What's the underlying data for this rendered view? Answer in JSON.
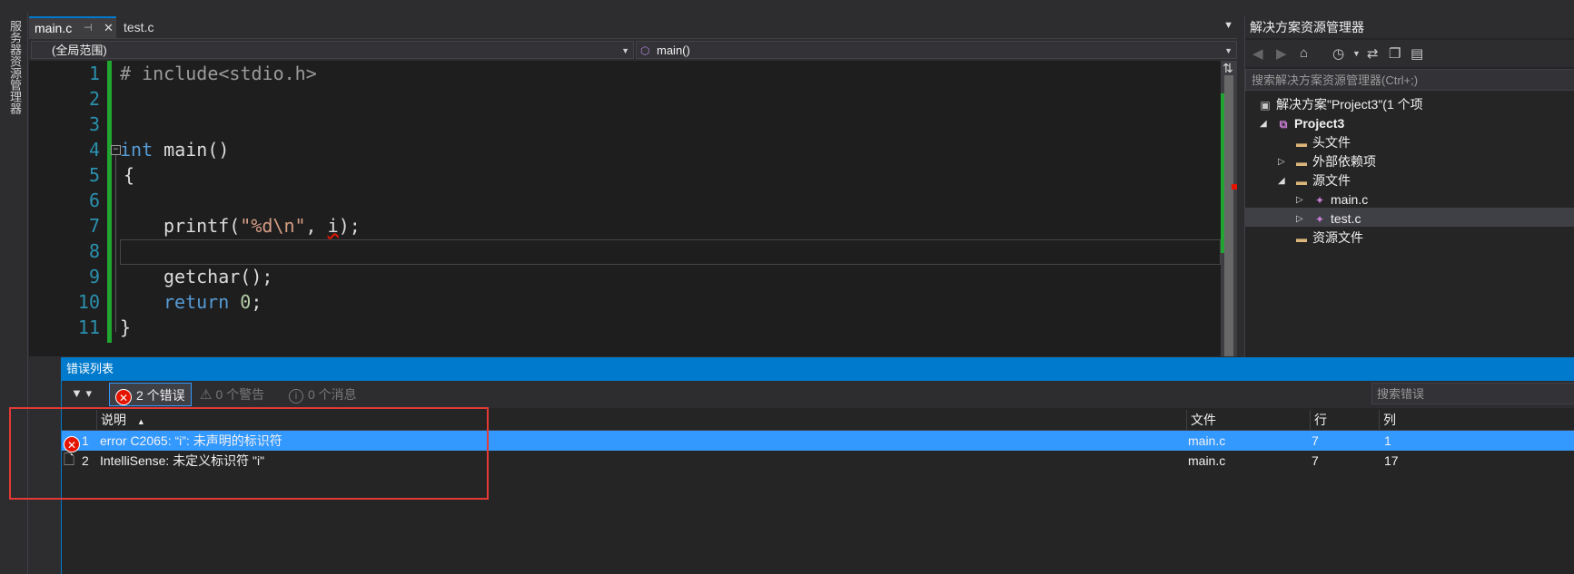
{
  "left_strip": {
    "label": "服务器资源管理器"
  },
  "tabs": [
    {
      "label": "main.c",
      "active": true
    },
    {
      "label": "test.c",
      "active": false
    }
  ],
  "navbar": {
    "scope": "(全局范围)",
    "function": "main()"
  },
  "editor": {
    "lines": [
      {
        "num": "1"
      },
      {
        "num": "2"
      },
      {
        "num": "3"
      },
      {
        "num": "4"
      },
      {
        "num": "5"
      },
      {
        "num": "6"
      },
      {
        "num": "7"
      },
      {
        "num": "8"
      },
      {
        "num": "9"
      },
      {
        "num": "10"
      },
      {
        "num": "11"
      }
    ],
    "code": {
      "l1_pp": "# include",
      "l1_hdr": "<stdio.h>",
      "l4_kw": "int",
      "l4_rest": " main()",
      "l5": "{",
      "l7_fn": "printf(",
      "l7_str": "\"%d\\n\"",
      "l7_sep": ", ",
      "l7_err": "i",
      "l7_end": ");",
      "l9": "getchar();",
      "l10_kw": "return",
      "l10_num": "0",
      "l10_end": ";",
      "l11": "}"
    }
  },
  "solution_explorer": {
    "title": "解决方案资源管理器",
    "search_placeholder": "搜索解决方案资源管理器(Ctrl+;)",
    "solution": "解决方案\"Project3\"(1 个项",
    "project": "Project3",
    "items": {
      "headers": "头文件",
      "external": "外部依赖项",
      "sources": "源文件",
      "main_c": "main.c",
      "test_c": "test.c",
      "resources": "资源文件"
    }
  },
  "error_list": {
    "title": "错误列表",
    "errors_btn": "2 个错误",
    "warnings_btn": "0 个警告",
    "messages_btn": "0 个消息",
    "search_placeholder": "搜索错误",
    "columns": {
      "desc": "说明",
      "file": "文件",
      "line": "行",
      "col": "列"
    },
    "rows": [
      {
        "num": "1",
        "desc": "error C2065: “i”: 未声明的标识符",
        "file": "main.c",
        "line": "7",
        "col": "1",
        "kind": "error"
      },
      {
        "num": "2",
        "desc": "IntelliSense:  未定义标识符 \"i\"",
        "file": "main.c",
        "line": "7",
        "col": "17",
        "kind": "intellisense"
      }
    ]
  },
  "colors": {
    "accent": "#007acc",
    "selection": "#3399ff",
    "error": "#e51400",
    "change_bar": "#1fa530",
    "annotation": "#e53935"
  }
}
